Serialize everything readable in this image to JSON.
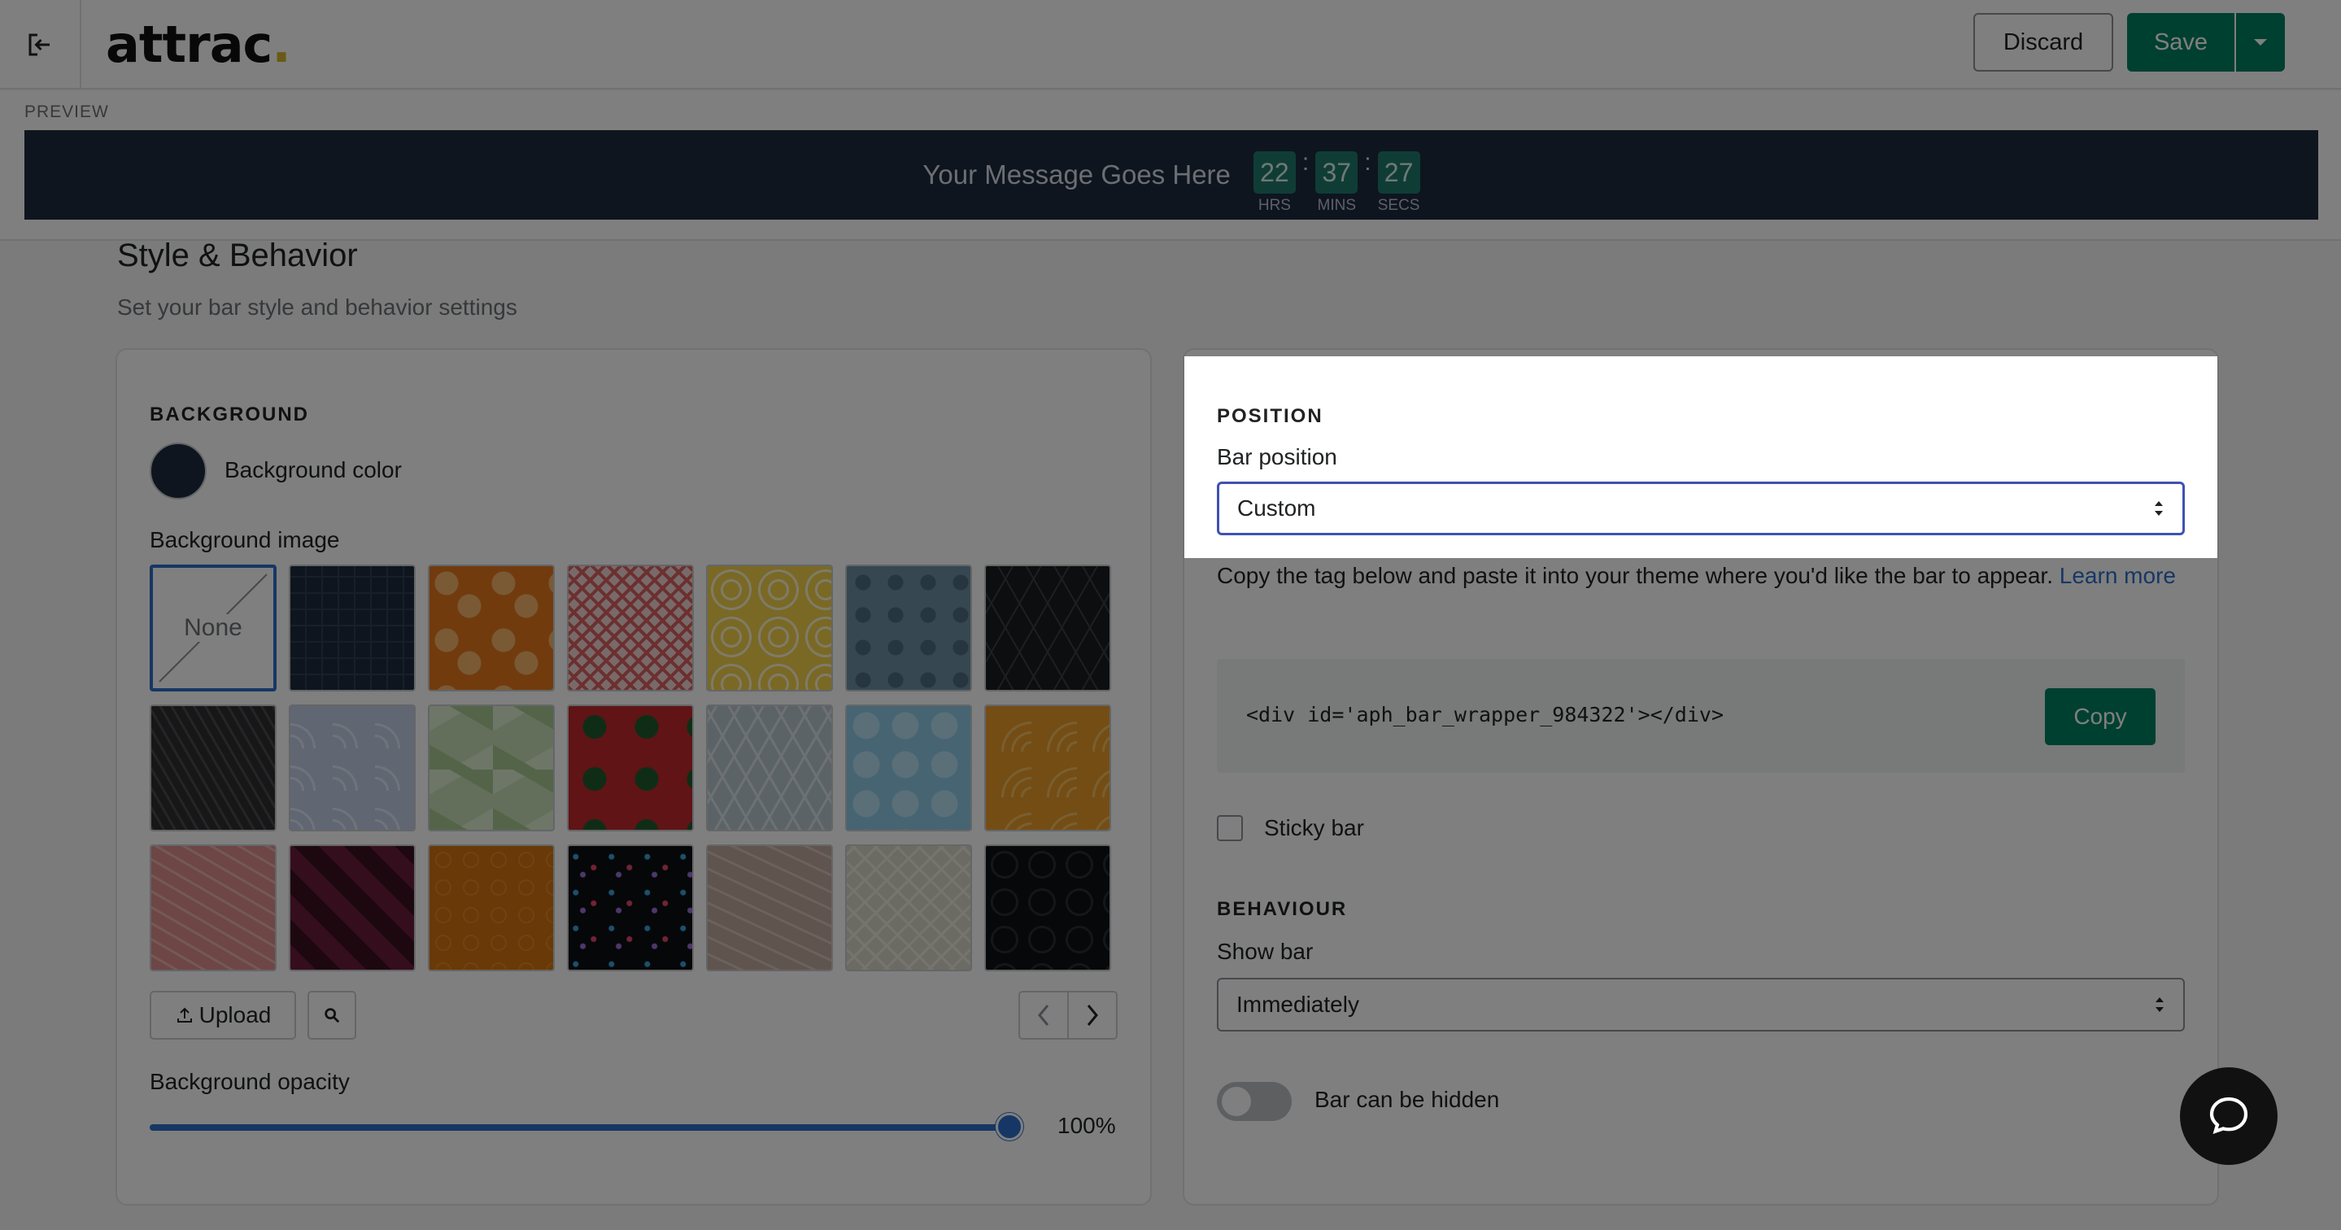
{
  "app": {
    "logo": "attrac",
    "logo_dot": "."
  },
  "header": {
    "discard_label": "Discard",
    "save_label": "Save"
  },
  "preview": {
    "label": "PREVIEW",
    "message": "Your Message Goes Here",
    "timer": [
      {
        "value": "22",
        "unit": "HRS"
      },
      {
        "value": "37",
        "unit": "MINS"
      },
      {
        "value": "27",
        "unit": "SECS"
      }
    ],
    "separator": ":"
  },
  "section": {
    "title": "Style & Behavior",
    "subtitle": "Set your bar style and behavior settings"
  },
  "background": {
    "heading": "BACKGROUND",
    "color_label": "Background color",
    "color": "#1c2a3f",
    "image_label": "Background image",
    "none_label": "None",
    "upload_label": "Upload",
    "opacity_label": "Background opacity",
    "opacity_value": "100%",
    "opacity_fraction": 1.0
  },
  "position": {
    "heading": "POSITION",
    "bar_position_label": "Bar position",
    "bar_position_value": "Custom",
    "copy_instructions": "Copy the tag below and paste it into your theme where you'd like the bar to appear.",
    "learn_more": "Learn more",
    "code": "<div id='aph_bar_wrapper_984322'></div>",
    "copy_label": "Copy",
    "sticky_label": "Sticky bar"
  },
  "behaviour": {
    "heading": "BEHAVIOUR",
    "show_bar_label": "Show bar",
    "show_bar_value": "Immediately",
    "hidden_label": "Bar can be hidden"
  },
  "colors": {
    "accent": "#008060",
    "focus": "#3f51b5",
    "link": "#2c6ecb",
    "bar_bg": "#1c2a3f",
    "timer_bg": "#1f7a6c"
  },
  "icons": [
    "exit-icon",
    "chevron-down-icon",
    "upload-icon",
    "search-icon",
    "chevron-left-icon",
    "chevron-right-icon",
    "select-arrows-icon",
    "chat-icon"
  ]
}
